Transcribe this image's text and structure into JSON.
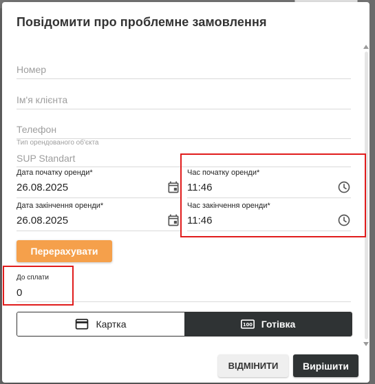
{
  "dialog": {
    "title": "Повідомити про проблемне замовлення"
  },
  "form": {
    "number": {
      "placeholder": "Номер"
    },
    "client_name": {
      "placeholder": "Ім'я клієнта"
    },
    "phone": {
      "placeholder": "Телефон"
    },
    "rental_object": {
      "label": "Тип орендованого об'єкта",
      "value": "SUP Standart"
    },
    "start_date": {
      "label": "Дата початку оренди*",
      "value": "26.08.2025"
    },
    "start_time": {
      "label": "Час початку оренди*",
      "value": "11:46"
    },
    "end_date": {
      "label": "Дата закінчення оренди*",
      "value": "26.08.2025"
    },
    "end_time": {
      "label": "Час закінчення оренди*",
      "value": "11:46"
    },
    "recalculate_label": "Перерахувати",
    "to_pay": {
      "label": "До сплати",
      "value": "0"
    },
    "payment_method": {
      "options": [
        "Картка",
        "Готівка"
      ],
      "selected": "Готівка"
    }
  },
  "actions": {
    "cancel_label": "ВІДМІНИТИ",
    "resolve_label": "Вирішити"
  },
  "colors": {
    "accent_orange": "#f5a04b",
    "dark": "#2f3334",
    "highlight_red": "#e01b1b"
  },
  "icons": {
    "calendar": "calendar-icon",
    "clock": "clock-icon",
    "card": "credit-card-icon",
    "cash": "cash-icon"
  }
}
